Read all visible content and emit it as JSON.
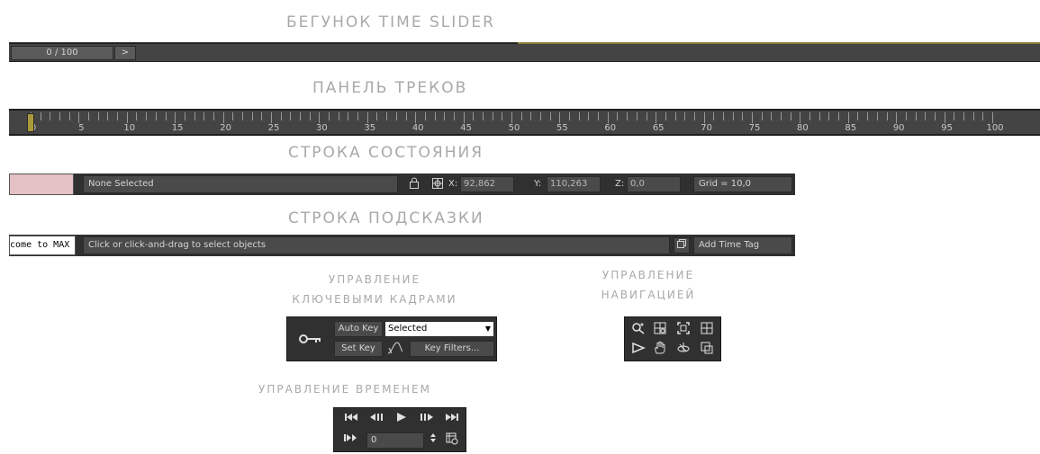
{
  "captions": {
    "time_slider": "БЕГУНОК TIME SLIDER",
    "track_bar": "ПАНЕЛЬ ТРЕКОВ",
    "status_bar": "СТРОКА СОСТОЯНИЯ",
    "prompt_bar": "СТРОКА ПОДСКАЗКИ",
    "key_controls_line1": "УПРАВЛЕНИЕ",
    "key_controls_line2": "КЛЮЧЕВЫМИ КАДРАМИ",
    "nav_controls_line1": "УПРАВЛЕНИЕ",
    "nav_controls_line2": "НАВИГАЦИЕЙ",
    "time_controls": "УПРАВЛЕНИЕ ВРЕМЕНЕМ"
  },
  "time_slider": {
    "thumb_label": "0 / 100",
    "next_label": ">"
  },
  "track_bar": {
    "range": [
      0,
      100
    ],
    "current_frame": 0,
    "labels": [
      "0",
      "5",
      "10",
      "15",
      "20",
      "25",
      "30",
      "35",
      "40",
      "45",
      "50",
      "55",
      "60",
      "65",
      "70",
      "75",
      "80",
      "85",
      "90",
      "95",
      "100"
    ]
  },
  "status_bar": {
    "selection_text": "None Selected",
    "x_label": "X:",
    "x_value": "92,862",
    "y_label": "Y:",
    "y_value": "110,263",
    "z_label": "Z:",
    "z_value": "0,0",
    "grid_text": "Grid = 10,0"
  },
  "prompt_bar": {
    "listener_text": "lcome to MAX",
    "prompt_text": "Click or click-and-drag to select objects",
    "add_time_tag": "Add Time Tag"
  },
  "key_controls": {
    "auto_key": "Auto Key",
    "set_key": "Set Key",
    "selection_mode": "Selected",
    "key_filters": "Key Filters..."
  },
  "time_controls": {
    "frame_value": "0"
  },
  "icons": {
    "lock": "lock-icon",
    "absolute_mode": "absolute-mode-icon",
    "key": "key-icon",
    "tangent": "default-tangent-icon",
    "time_tag": "time-tag-icon"
  },
  "colors": {
    "panel_dark": "#303030",
    "field_gray": "#4a4a4a",
    "caption_gray": "#a9a9a9",
    "status_swatch": "#e3c1c5",
    "frame_marker": "#a89a3a"
  }
}
